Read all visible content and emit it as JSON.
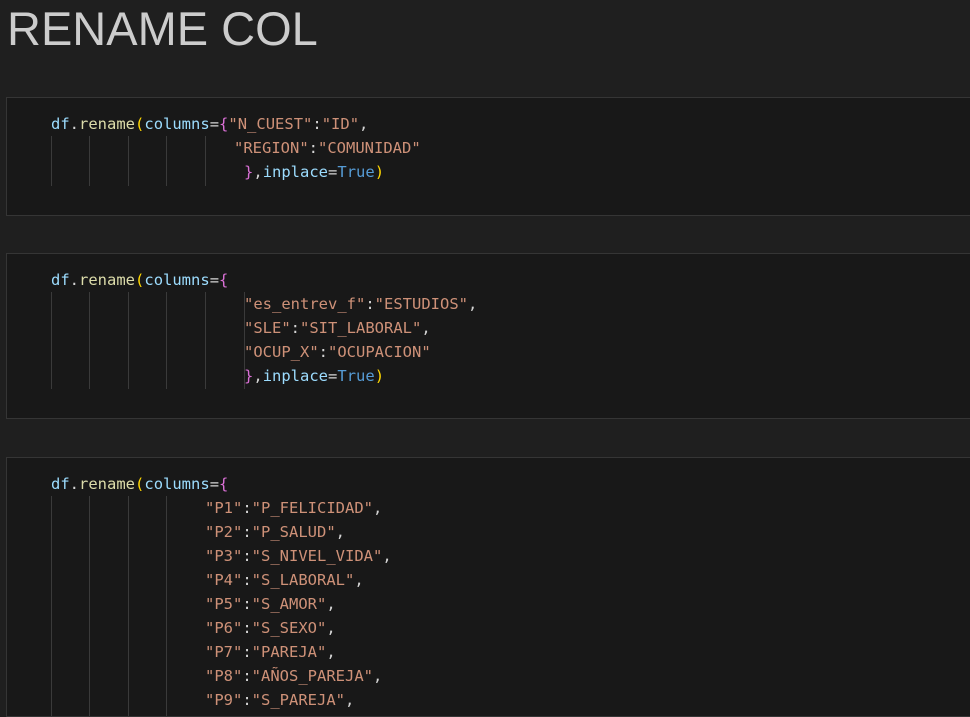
{
  "title": "RENAME COL",
  "cells": [
    {
      "lines": [
        [
          [
            "var",
            "df"
          ],
          [
            "pl",
            "."
          ],
          [
            "fn",
            "rename"
          ],
          [
            "br1",
            "("
          ],
          [
            "var",
            "columns"
          ],
          [
            "pl",
            "="
          ],
          [
            "br2",
            "{"
          ],
          [
            "str",
            "\"N_CUEST\""
          ],
          [
            "pl",
            ":"
          ],
          [
            "str",
            "\"ID\""
          ],
          [
            "pl",
            ","
          ]
        ],
        [
          [
            "str",
            "\"REGION\""
          ],
          [
            "pl",
            ":"
          ],
          [
            "str",
            "\"COMUNIDAD\""
          ]
        ],
        [
          [
            "br2",
            "}"
          ],
          [
            "pl",
            ","
          ],
          [
            "var",
            "inplace"
          ],
          [
            "pl",
            "="
          ],
          [
            "kw",
            "True"
          ],
          [
            "br1",
            ")"
          ]
        ]
      ]
    },
    {
      "lines": [
        [
          [
            "var",
            "df"
          ],
          [
            "pl",
            "."
          ],
          [
            "fn",
            "rename"
          ],
          [
            "br1",
            "("
          ],
          [
            "var",
            "columns"
          ],
          [
            "pl",
            "="
          ],
          [
            "br2",
            "{"
          ]
        ],
        [
          [
            "str",
            "\"es_entrev_f\""
          ],
          [
            "pl",
            ":"
          ],
          [
            "str",
            "\"ESTUDIOS\""
          ],
          [
            "pl",
            ","
          ]
        ],
        [
          [
            "str",
            "\"SLE\""
          ],
          [
            "pl",
            ":"
          ],
          [
            "str",
            "\"SIT_LABORAL\""
          ],
          [
            "pl",
            ","
          ]
        ],
        [
          [
            "str",
            "\"OCUP_X\""
          ],
          [
            "pl",
            ":"
          ],
          [
            "str",
            "\"OCUPACION\""
          ]
        ],
        [
          [
            "br2",
            "}"
          ],
          [
            "pl",
            ","
          ],
          [
            "var",
            "inplace"
          ],
          [
            "pl",
            "="
          ],
          [
            "kw",
            "True"
          ],
          [
            "br1",
            ")"
          ]
        ]
      ]
    },
    {
      "lines": [
        [
          [
            "var",
            "df"
          ],
          [
            "pl",
            "."
          ],
          [
            "fn",
            "rename"
          ],
          [
            "br1",
            "("
          ],
          [
            "var",
            "columns"
          ],
          [
            "pl",
            "="
          ],
          [
            "br2",
            "{"
          ]
        ],
        [
          [
            "str",
            "\"P1\""
          ],
          [
            "pl",
            ":"
          ],
          [
            "str",
            "\"P_FELICIDAD\""
          ],
          [
            "pl",
            ","
          ]
        ],
        [
          [
            "str",
            "\"P2\""
          ],
          [
            "pl",
            ":"
          ],
          [
            "str",
            "\"P_SALUD\""
          ],
          [
            "pl",
            ","
          ]
        ],
        [
          [
            "str",
            "\"P3\""
          ],
          [
            "pl",
            ":"
          ],
          [
            "str",
            "\"S_NIVEL_VIDA\""
          ],
          [
            "pl",
            ","
          ]
        ],
        [
          [
            "str",
            "\"P4\""
          ],
          [
            "pl",
            ":"
          ],
          [
            "str",
            "\"S_LABORAL\""
          ],
          [
            "pl",
            ","
          ]
        ],
        [
          [
            "str",
            "\"P5\""
          ],
          [
            "pl",
            ":"
          ],
          [
            "str",
            "\"S_AMOR\""
          ],
          [
            "pl",
            ","
          ]
        ],
        [
          [
            "str",
            "\"P6\""
          ],
          [
            "pl",
            ":"
          ],
          [
            "str",
            "\"S_SEXO\""
          ],
          [
            "pl",
            ","
          ]
        ],
        [
          [
            "str",
            "\"P7\""
          ],
          [
            "pl",
            ":"
          ],
          [
            "str",
            "\"PAREJA\""
          ],
          [
            "pl",
            ","
          ]
        ],
        [
          [
            "str",
            "\"P8\""
          ],
          [
            "pl",
            ":"
          ],
          [
            "str",
            "\"AÑOS_PAREJA\""
          ],
          [
            "pl",
            ","
          ]
        ],
        [
          [
            "str",
            "\"P9\""
          ],
          [
            "pl",
            ":"
          ],
          [
            "str",
            "\"S_PAREJA\""
          ],
          [
            "pl",
            ","
          ]
        ]
      ]
    }
  ],
  "colors": {
    "background": "#1f1f1f",
    "cell_background": "#181818",
    "string": "#ce9178",
    "variable": "#9cdcfe",
    "function": "#dcdcaa",
    "keyword": "#569cd6",
    "bracket_level1": "#ffd700",
    "bracket_level2": "#da70d6"
  }
}
